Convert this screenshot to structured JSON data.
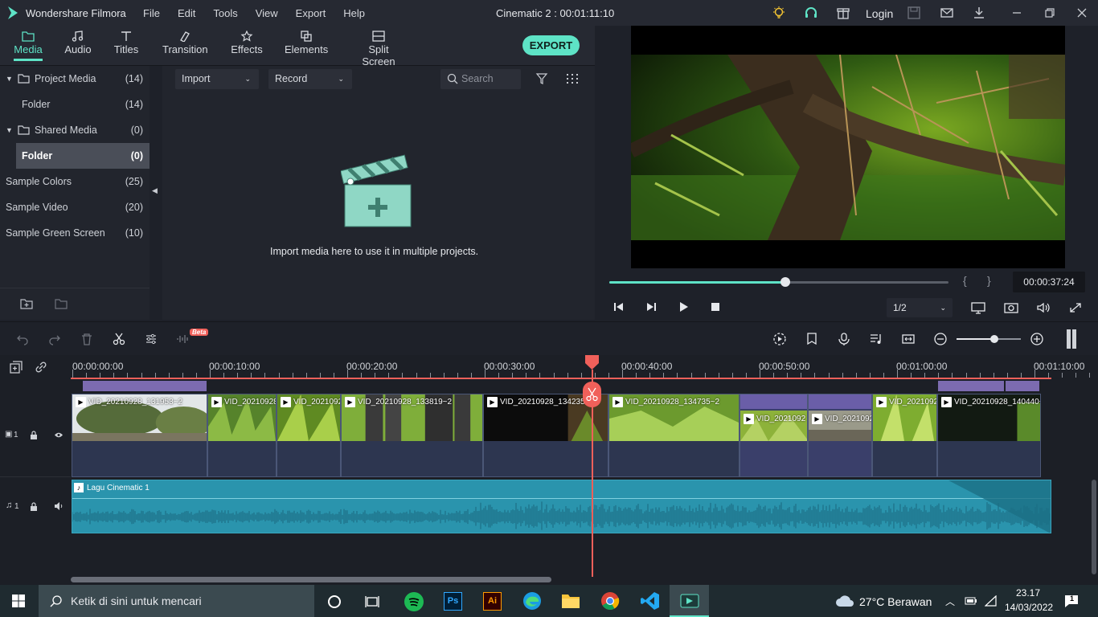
{
  "app": {
    "title": "Wondershare Filmora",
    "project_title": "Cinematic 2 : 00:01:11:10",
    "login": "Login"
  },
  "menu": [
    "File",
    "Edit",
    "Tools",
    "View",
    "Export",
    "Help"
  ],
  "tabs": [
    {
      "label": "Media",
      "icon": "folder-icon",
      "active": true
    },
    {
      "label": "Audio",
      "icon": "music-icon"
    },
    {
      "label": "Titles",
      "icon": "text-icon"
    },
    {
      "label": "Transition",
      "icon": "transition-icon"
    },
    {
      "label": "Effects",
      "icon": "effects-icon"
    },
    {
      "label": "Elements",
      "icon": "elements-icon"
    },
    {
      "label": "Split Screen",
      "icon": "split-screen-icon"
    }
  ],
  "export_label": "EXPORT",
  "sidebar": {
    "items": [
      {
        "label": "Project Media",
        "count": "(14)"
      },
      {
        "label": "Folder",
        "count": "(14)"
      },
      {
        "label": "Shared Media",
        "count": "(0)"
      },
      {
        "label": "Folder",
        "count": "(0)"
      },
      {
        "label": "Sample Colors",
        "count": "(25)"
      },
      {
        "label": "Sample Video",
        "count": "(20)"
      },
      {
        "label": "Sample Green Screen",
        "count": "(10)"
      }
    ]
  },
  "media": {
    "import": "Import",
    "record": "Record",
    "search_placeholder": "Search",
    "empty_text": "Import media here to use it in multiple projects."
  },
  "preview": {
    "timecode": "00:00:37:24",
    "progress": 0.52,
    "zoom": "1/2",
    "bracket_in": "{",
    "bracket_out": "}"
  },
  "toolbar": {
    "beta": "Beta"
  },
  "ruler": [
    "00:00:00:00",
    "00:00:10:00",
    "00:00:20:00",
    "00:00:30:00",
    "00:00:40:00",
    "00:00:50:00",
    "00:01:00:00",
    "00:01:10:00"
  ],
  "clips": [
    {
      "name": "VID_20210928_131953~2"
    },
    {
      "name": "VID_20210928"
    },
    {
      "name": "VID_2021092"
    },
    {
      "name": "VID_20210928_133819~2"
    },
    {
      "name": "VID_20210928_134235"
    },
    {
      "name": "VID_20210928_134735~2"
    },
    {
      "name": "VID_2021092"
    },
    {
      "name": "VID_2021092"
    },
    {
      "name": "VID_2021092"
    },
    {
      "name": "VID_20210928_140440~"
    }
  ],
  "track_labels": {
    "video": "1",
    "audio": "1"
  },
  "audio_clip": {
    "name": "Lagu Cinematic 1"
  },
  "colors": {
    "accent": "#5ee3c6",
    "playhead": "#f0605a",
    "audio": "#2a94ad",
    "clip_bg": "#2d3650"
  },
  "taskbar": {
    "search_placeholder": "Ketik di sini untuk mencari",
    "weather": "27°C  Berawan",
    "time": "23.17",
    "date": "14/03/2022",
    "notif_count": "1"
  }
}
